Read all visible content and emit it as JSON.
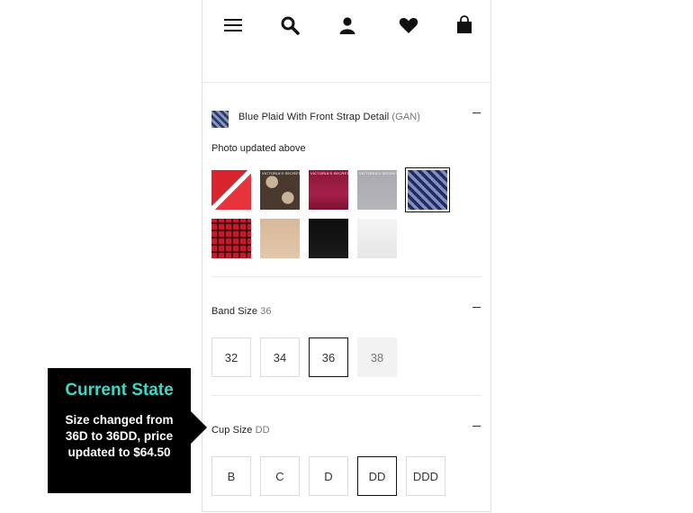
{
  "nav": {
    "menu_icon": "menu-icon",
    "search_icon": "search-icon",
    "account_icon": "account-icon",
    "wishlist_icon": "heart-icon",
    "bag_icon": "bag-icon"
  },
  "color_section": {
    "name": "Blue Plaid With Front Strap Detail",
    "code": "(GAN)",
    "photo_note": "Photo updated above",
    "swatches": [
      {
        "label": "",
        "color": "#d9232d"
      },
      {
        "label": "VICTORIA'S SECRET",
        "color": "#5a4638"
      },
      {
        "label": "VICTORIA'S SECRET",
        "color": "#8b1638"
      },
      {
        "label": "VICTORIA'S SECRET",
        "color": "#a9a9ae"
      },
      {
        "label": "",
        "color": "#2f3f76",
        "selected": true
      },
      {
        "label": "",
        "color": "#c8192b"
      },
      {
        "label": "",
        "color": "#d8b89a"
      },
      {
        "label": "",
        "color": "#111111"
      },
      {
        "label": "",
        "color": "#efefef"
      }
    ]
  },
  "band_section": {
    "label": "Band Size",
    "value": "36",
    "options": [
      {
        "label": "32"
      },
      {
        "label": "34"
      },
      {
        "label": "36",
        "selected": true
      },
      {
        "label": "38",
        "disabled": true
      }
    ]
  },
  "cup_section": {
    "label": "Cup Size",
    "value": "DD",
    "options": [
      {
        "label": "B"
      },
      {
        "label": "C"
      },
      {
        "label": "D"
      },
      {
        "label": "DD",
        "selected": true
      },
      {
        "label": "DDD"
      }
    ]
  },
  "callout": {
    "title": "Current State",
    "body": "Size changed from 36D to 36DD, price updated to $64.50",
    "title_color": "#37d9c9"
  }
}
